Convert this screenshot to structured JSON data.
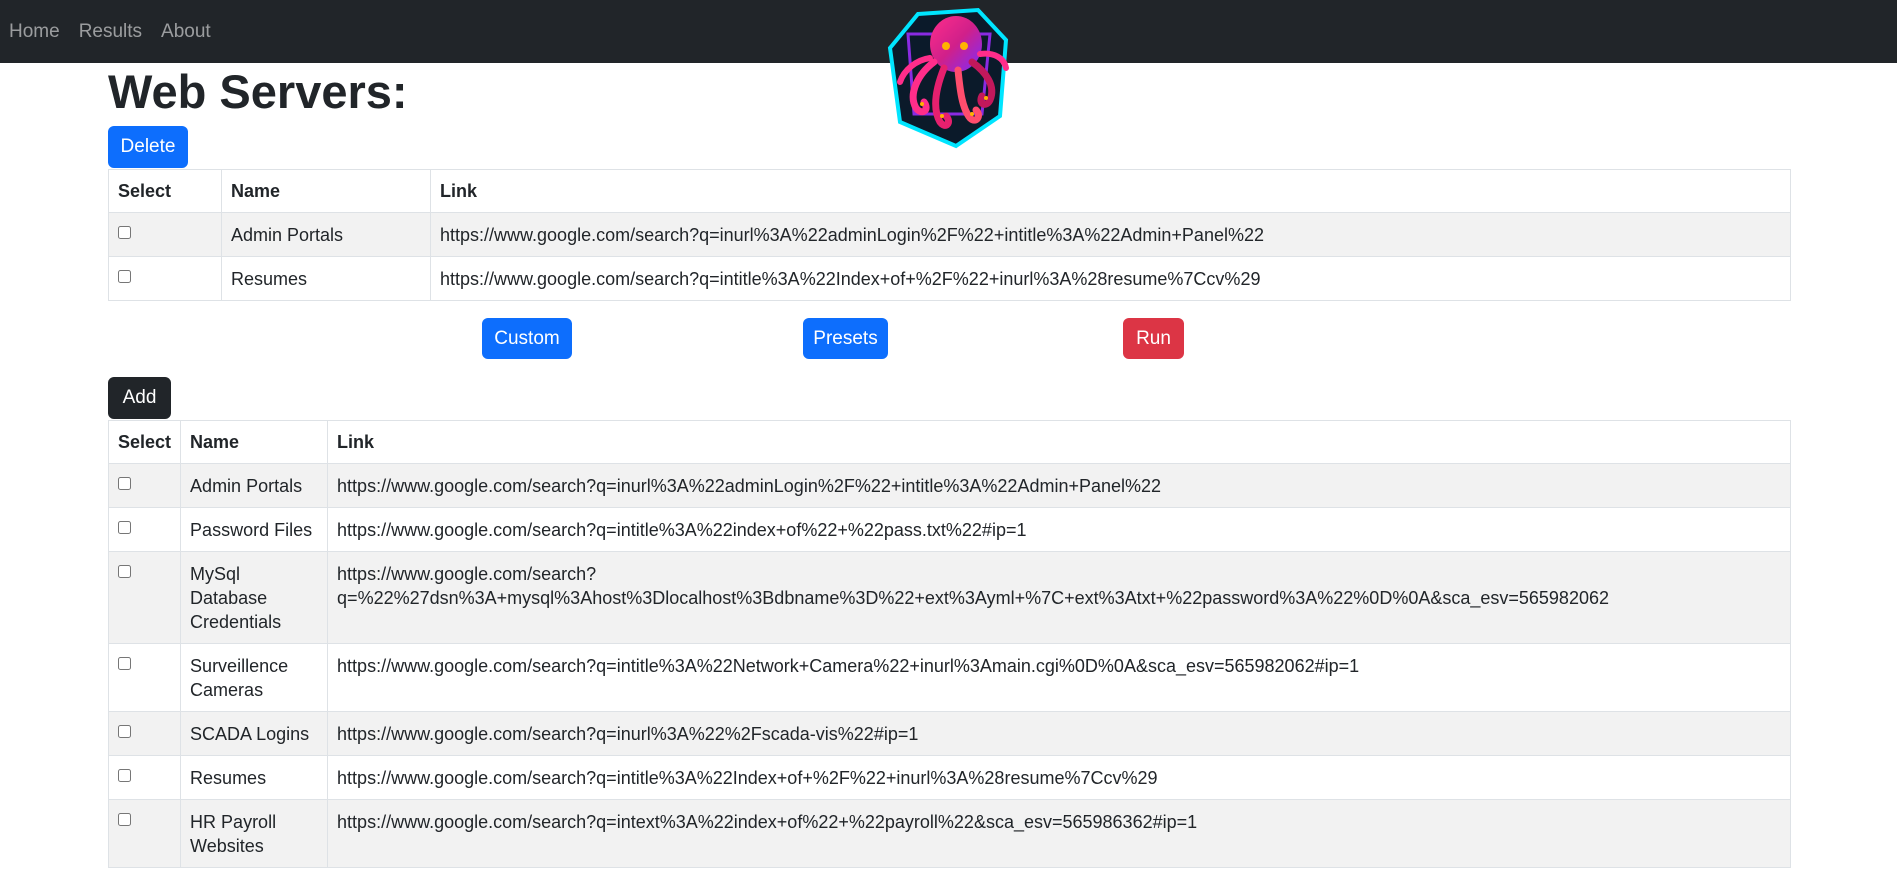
{
  "nav": {
    "home": "Home",
    "results": "Results",
    "about": "About"
  },
  "logo": {
    "icon": "octopus-logo",
    "colors": [
      "#ff2d8a",
      "#8a2be2",
      "#00e5ff",
      "#ffb300"
    ]
  },
  "page_title": "Web Servers:",
  "buttons": {
    "delete": "Delete",
    "custom": "Custom",
    "presets": "Presets",
    "run": "Run",
    "add": "Add"
  },
  "selected_table": {
    "headers": [
      "Select",
      "Name",
      "Link"
    ],
    "rows": [
      {
        "name": "Admin Portals",
        "link": "https://www.google.com/search?q=inurl%3A%22adminLogin%2F%22+intitle%3A%22Admin+Panel%22"
      },
      {
        "name": "Resumes",
        "link": "https://www.google.com/search?q=intitle%3A%22Index+of+%2F%22+inurl%3A%28resume%7Ccv%29"
      }
    ]
  },
  "presets_table": {
    "headers": [
      "Select",
      "Name",
      "Link"
    ],
    "rows": [
      {
        "name": "Admin Portals",
        "link": "https://www.google.com/search?q=inurl%3A%22adminLogin%2F%22+intitle%3A%22Admin+Panel%22"
      },
      {
        "name": "Password Files",
        "link": "https://www.google.com/search?q=intitle%3A%22index+of%22+%22pass.txt%22#ip=1"
      },
      {
        "name": "MySql Database Credentials",
        "link": "https://www.google.com/search?q=%22%27dsn%3A+mysql%3Ahost%3Dlocalhost%3Bdbname%3D%22+ext%3Ayml+%7C+ext%3Atxt+%22password%3A%22%0D%0A&sca_esv=565982062"
      },
      {
        "name": "Surveillence Cameras",
        "link": "https://www.google.com/search?q=intitle%3A%22Network+Camera%22+inurl%3Amain.cgi%0D%0A&sca_esv=565982062#ip=1"
      },
      {
        "name": "SCADA Logins",
        "link": "https://www.google.com/search?q=inurl%3A%22%2Fscada-vis%22#ip=1"
      },
      {
        "name": "Resumes",
        "link": "https://www.google.com/search?q=intitle%3A%22Index+of+%2F%22+inurl%3A%28resume%7Ccv%29"
      },
      {
        "name": "HR Payroll Websites",
        "link": "https://www.google.com/search?q=intext%3A%22index+of%22+%22payroll%22&sca_esv=565986362#ip=1"
      }
    ]
  }
}
